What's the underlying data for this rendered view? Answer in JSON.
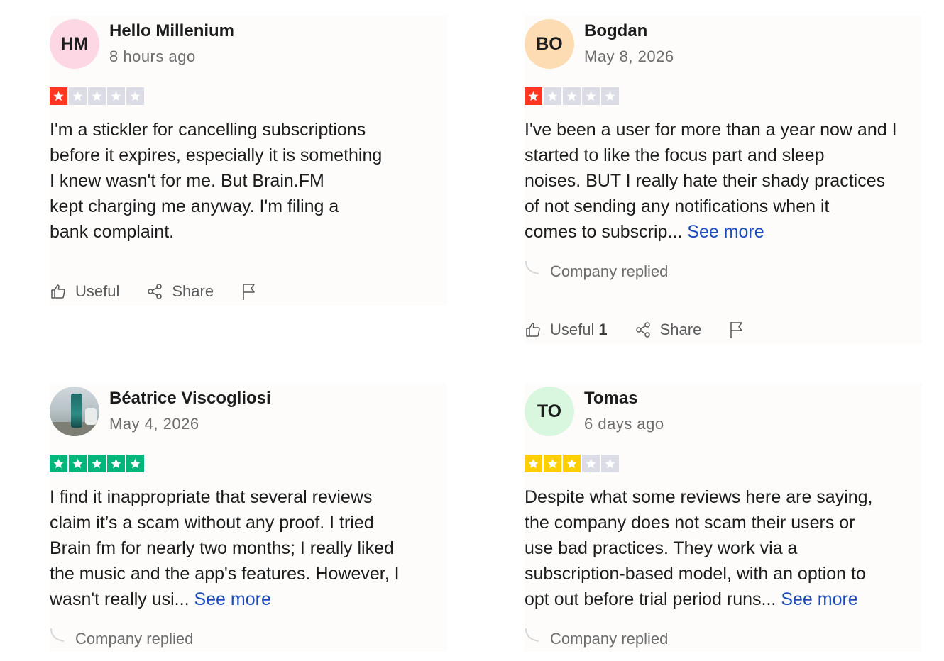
{
  "reviews": [
    {
      "initials": "HM",
      "name": "Hello Millenium",
      "date": "8 hours ago",
      "rating": 1,
      "lines": [
        "I'm a stickler for cancelling subscriptions",
        "before it expires, especially it is something",
        "I knew wasn't for me. But Brain.FM",
        "kept charging me anyway. I'm filing a",
        "bank complaint."
      ],
      "useful_label": "Useful",
      "share_label": "Share"
    },
    {
      "initials": "BO",
      "name": "Bogdan",
      "date": "May 8, 2026",
      "rating": 1,
      "lines": [
        "I've been a user for more than a year now and I",
        "started to like the focus part and sleep",
        "noises. BUT I really hate their shady practices",
        "of not sending any notifications when it"
      ],
      "last_line": "comes to subscrip...",
      "see_more": "See more",
      "company_replied": "Company replied",
      "useful_label": "Useful",
      "useful_count": "1",
      "share_label": "Share"
    },
    {
      "name": "Béatrice Viscogliosi",
      "date": "May 4, 2026",
      "rating": 5,
      "lines": [
        "I find it inappropriate that several reviews",
        "claim it’s a scam without any proof. I tried",
        "Brain fm for nearly two months; I really liked",
        "the music and the app's features. However, I"
      ],
      "last_line": "wasn't really usi...",
      "see_more": "See more",
      "company_replied": "Company replied"
    },
    {
      "initials": "TO",
      "name": "Tomas",
      "date": "6 days ago",
      "rating": 3,
      "lines": [
        "Despite what some reviews here are saying,",
        "the company does not scam their users or",
        "use bad practices. They work via a",
        "subscription-based model, with an option to"
      ],
      "last_line": "opt out before trial period runs...",
      "see_more": "See more",
      "company_replied": "Company replied"
    }
  ],
  "colors": {
    "star_one": "#ff3722",
    "star_three": "#ffce00",
    "star_five": "#00b67a",
    "star_off": "#dcdce6",
    "link": "#1c4bbb"
  },
  "icons": [
    "thumbs-up-icon",
    "share-icon",
    "flag-icon",
    "reply-curve-icon",
    "star-icon"
  ]
}
